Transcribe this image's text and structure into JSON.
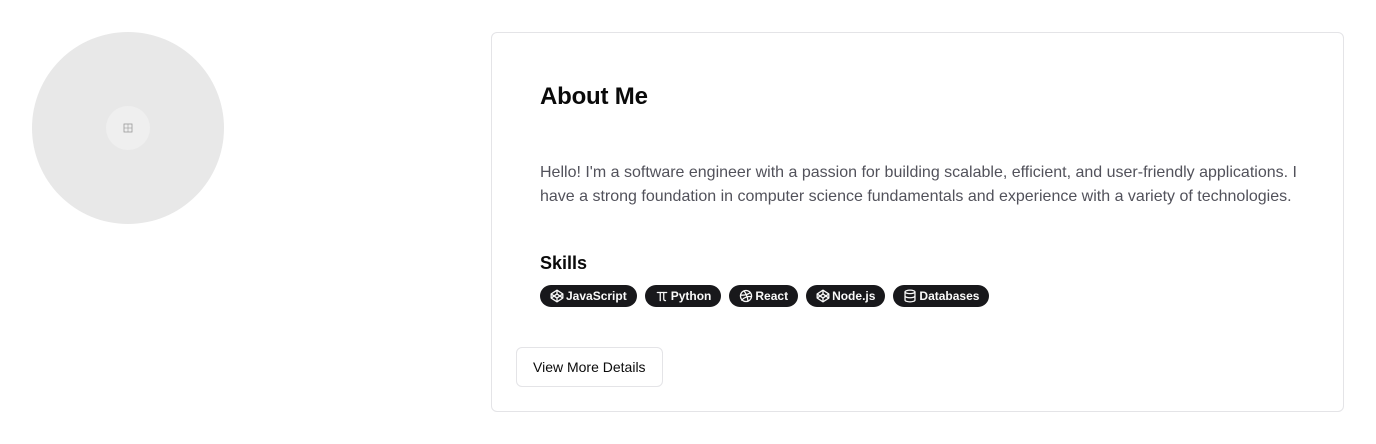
{
  "profile": {
    "avatar_icon": "image-placeholder-icon"
  },
  "about": {
    "title": "About Me",
    "bio": "Hello! I'm a software engineer with a passion for building scalable, efficient, and user-friendly applications. I have a strong foundation in computer science fundamentals and experience with a variety of technologies.",
    "skills_title": "Skills",
    "skills": [
      {
        "label": "JavaScript",
        "icon": "codepen-icon"
      },
      {
        "label": "Python",
        "icon": "pi-icon"
      },
      {
        "label": "React",
        "icon": "dribbble-icon"
      },
      {
        "label": "Node.js",
        "icon": "codepen-icon"
      },
      {
        "label": "Databases",
        "icon": "database-icon"
      }
    ],
    "details_button": "View More Details"
  },
  "colors": {
    "chip_bg": "#18181b",
    "bio_text": "#52525b",
    "avatar_bg": "#e8e8e8"
  }
}
